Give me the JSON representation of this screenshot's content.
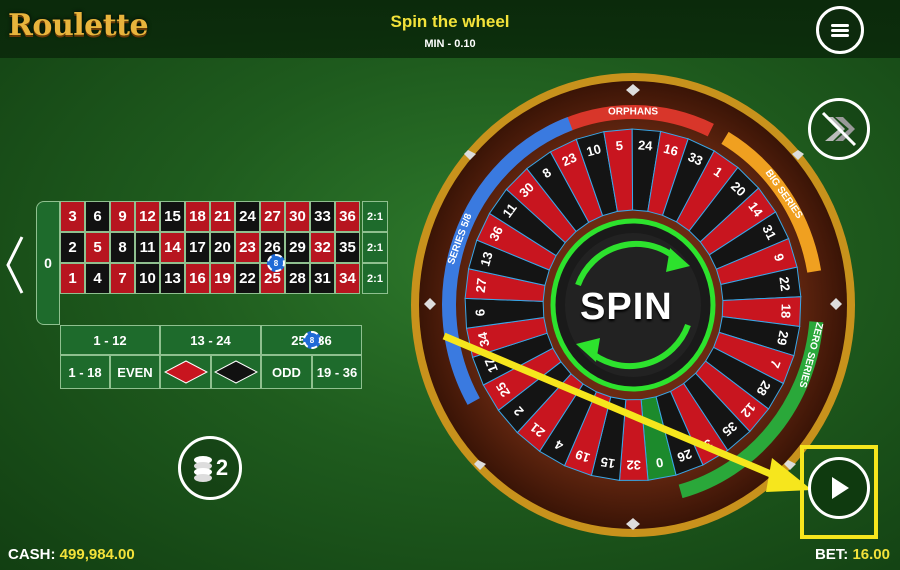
{
  "header": {
    "logo": "Roulette",
    "title": "Spin the wheel",
    "min_label": "MIN - 0.10"
  },
  "icons": {
    "menu": "hamburger-menu-icon",
    "turbo": "turbo-off-icon",
    "chips": "chip-stack-icon",
    "play": "play-icon",
    "back": "chevron-left-icon"
  },
  "chips_button": {
    "count": "2"
  },
  "table": {
    "zero": "0",
    "rows": [
      [
        {
          "n": "3",
          "c": "red"
        },
        {
          "n": "6",
          "c": "black"
        },
        {
          "n": "9",
          "c": "red"
        },
        {
          "n": "12",
          "c": "red"
        },
        {
          "n": "15",
          "c": "black"
        },
        {
          "n": "18",
          "c": "red"
        },
        {
          "n": "21",
          "c": "red"
        },
        {
          "n": "24",
          "c": "black"
        },
        {
          "n": "27",
          "c": "red"
        },
        {
          "n": "30",
          "c": "red"
        },
        {
          "n": "33",
          "c": "black"
        },
        {
          "n": "36",
          "c": "red"
        }
      ],
      [
        {
          "n": "2",
          "c": "black"
        },
        {
          "n": "5",
          "c": "red"
        },
        {
          "n": "8",
          "c": "black"
        },
        {
          "n": "11",
          "c": "black"
        },
        {
          "n": "14",
          "c": "red"
        },
        {
          "n": "17",
          "c": "black"
        },
        {
          "n": "20",
          "c": "black"
        },
        {
          "n": "23",
          "c": "red"
        },
        {
          "n": "26",
          "c": "black"
        },
        {
          "n": "29",
          "c": "black"
        },
        {
          "n": "32",
          "c": "red"
        },
        {
          "n": "35",
          "c": "black"
        }
      ],
      [
        {
          "n": "1",
          "c": "red"
        },
        {
          "n": "4",
          "c": "black"
        },
        {
          "n": "7",
          "c": "red"
        },
        {
          "n": "10",
          "c": "black"
        },
        {
          "n": "13",
          "c": "black"
        },
        {
          "n": "16",
          "c": "red"
        },
        {
          "n": "19",
          "c": "red"
        },
        {
          "n": "22",
          "c": "black"
        },
        {
          "n": "25",
          "c": "red"
        },
        {
          "n": "28",
          "c": "black"
        },
        {
          "n": "31",
          "c": "black"
        },
        {
          "n": "34",
          "c": "red"
        }
      ]
    ],
    "column_bets": [
      "2:1",
      "2:1",
      "2:1"
    ],
    "dozens": [
      "1 - 12",
      "13 - 24",
      "25 - 36"
    ],
    "outside": {
      "low": "1 - 18",
      "even": "EVEN",
      "odd": "ODD",
      "high": "19 - 36"
    },
    "chips_on_table": [
      {
        "label": "8",
        "on": "23-26 split"
      },
      {
        "label": "8",
        "on": "25 - 36 dozen"
      }
    ]
  },
  "wheel": {
    "spin_label": "SPIN",
    "sections": [
      "ORPHANS",
      "BIG SERIES",
      "ZERO SERIES",
      "SERIES 5/8"
    ],
    "numbers_order": [
      "0",
      "32",
      "15",
      "19",
      "4",
      "21",
      "2",
      "25",
      "17",
      "34",
      "6",
      "27",
      "13",
      "36",
      "11",
      "30",
      "8",
      "23",
      "10",
      "5",
      "24",
      "16",
      "33",
      "1",
      "20",
      "14",
      "31",
      "9",
      "22",
      "18",
      "29",
      "7",
      "28",
      "12",
      "35",
      "3",
      "26"
    ],
    "red_numbers": [
      "32",
      "19",
      "21",
      "25",
      "34",
      "27",
      "36",
      "30",
      "23",
      "5",
      "16",
      "1",
      "14",
      "9",
      "18",
      "7",
      "12",
      "3"
    ],
    "colors": {
      "red": "#c8151f",
      "black": "#141414",
      "green": "#1c8a2c",
      "accent_blue": "#3aa7e8"
    }
  },
  "footer": {
    "cash_label": "CASH:",
    "cash_value": "499,984.00",
    "bet_label": "BET:",
    "bet_value": "16.00"
  }
}
